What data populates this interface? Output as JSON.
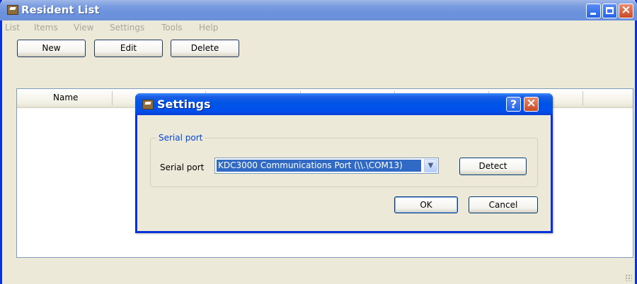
{
  "main_window": {
    "title": "Resident List",
    "menu": [
      "List",
      "Items",
      "View",
      "Settings",
      "Tools",
      "Help"
    ],
    "toolbar": {
      "new_label": "New",
      "edit_label": "Edit",
      "delete_label": "Delete"
    },
    "list": {
      "columns": [
        "Name",
        "",
        "",
        "",
        "",
        ""
      ]
    }
  },
  "settings_dialog": {
    "title": "Settings",
    "help_glyph": "?",
    "group_title": "Serial port",
    "serial_label": "Serial port",
    "serial_value": "KDC3000 Communications Port (\\\\.\\COM13)",
    "detect_label": "Detect",
    "ok_label": "OK",
    "cancel_label": "Cancel"
  },
  "icons": {
    "app_icon": "app-icon",
    "close": "close-icon",
    "minimize": "minimize-icon",
    "maximize": "maximize-icon",
    "dropdown": "chevron-down-icon"
  },
  "colors": {
    "dialog_title_bar": "#0054e3",
    "inactive_title_bar": "#7a9ce0",
    "window_face": "#ece9d8",
    "selection": "#316ac5",
    "group_title": "#0046d5"
  }
}
